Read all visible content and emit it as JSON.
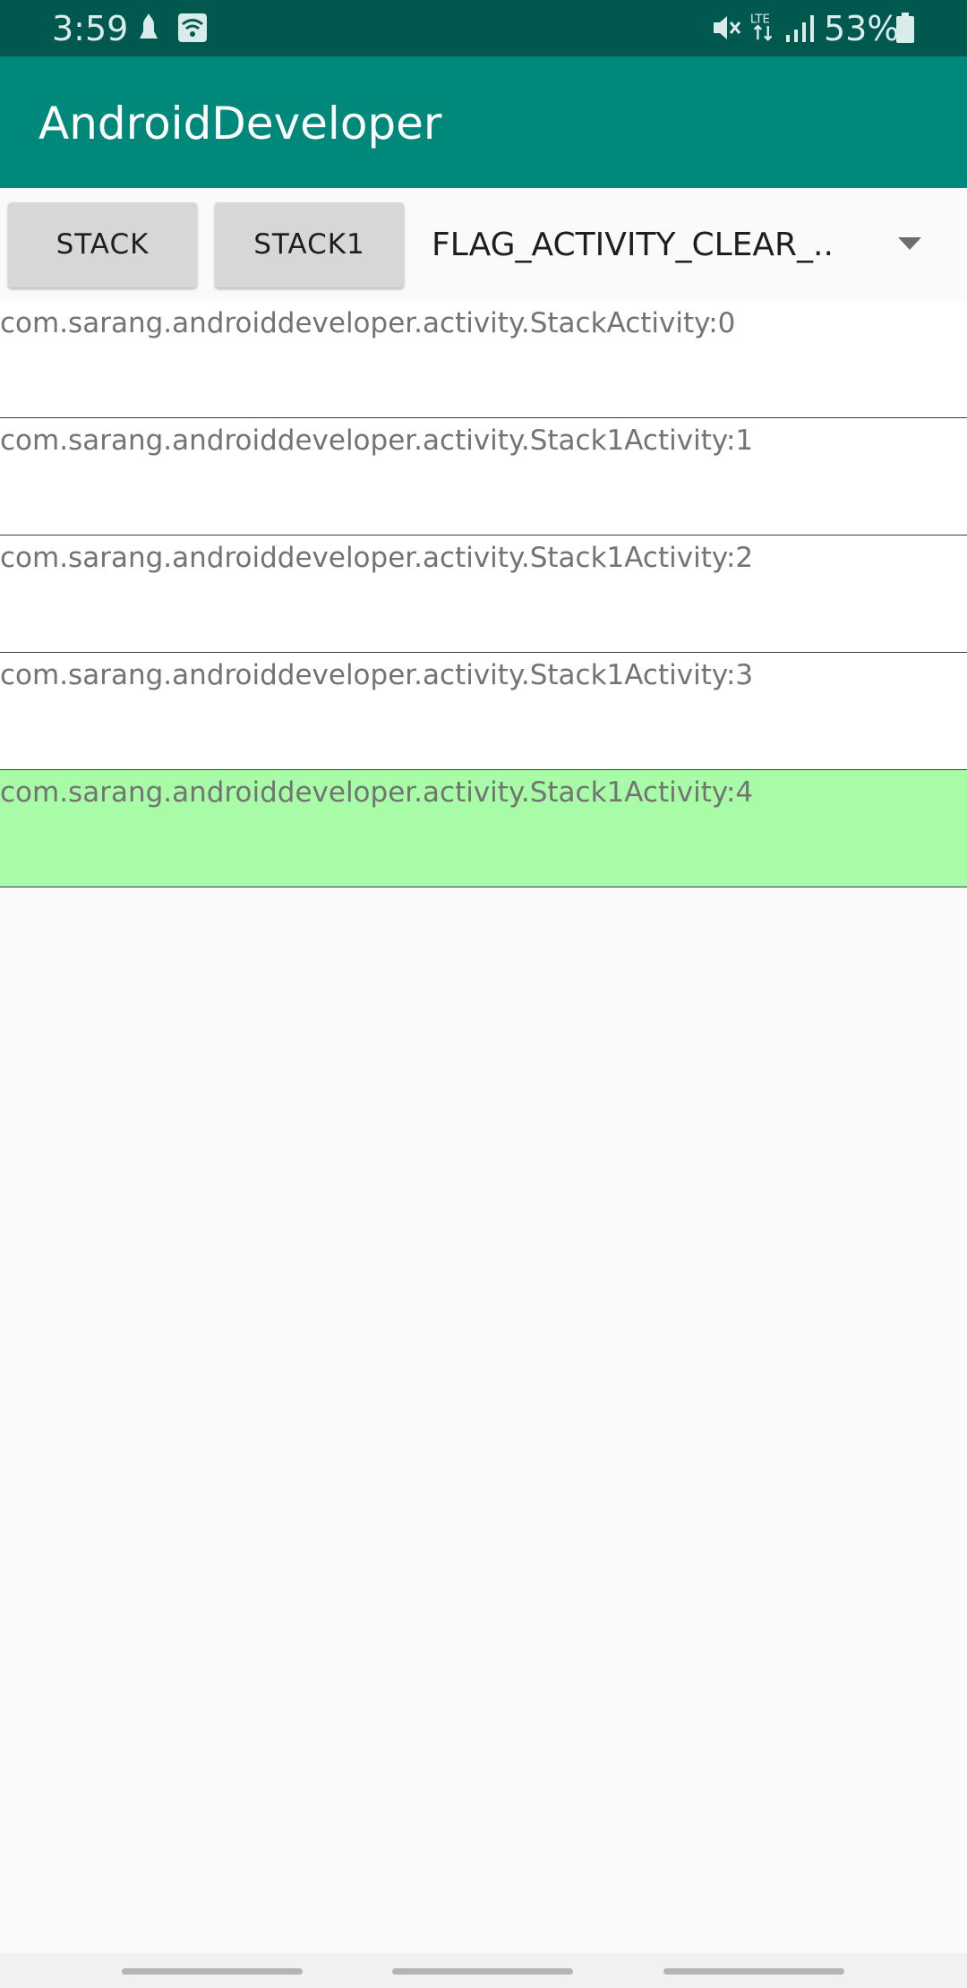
{
  "status_bar": {
    "time": "3:59",
    "icons": [
      "notification-icon",
      "wifi-icon",
      "mute-icon",
      "lte-icon",
      "signal-icon",
      "battery-icon"
    ],
    "battery_percent": "53%",
    "lte_label": "LTE"
  },
  "app_bar": {
    "title": "AndroidDeveloper",
    "color": "#00897b"
  },
  "controls": {
    "stack_button": "STACK",
    "stack1_button": "STACK1",
    "flag_spinner": {
      "selected": "FLAG_ACTIVITY_CLEAR_.."
    }
  },
  "activity_stack": {
    "rows": [
      {
        "label": "com.sarang.androiddeveloper.activity.StackActivity:0"
      },
      {
        "label": "com.sarang.androiddeveloper.activity.Stack1Activity:1"
      },
      {
        "label": "com.sarang.androiddeveloper.activity.Stack1Activity:2"
      },
      {
        "label": "com.sarang.androiddeveloper.activity.Stack1Activity:3"
      },
      {
        "label": "com.sarang.androiddeveloper.activity.Stack1Activity:4"
      }
    ],
    "selected_row_color": "#a8fba7"
  }
}
